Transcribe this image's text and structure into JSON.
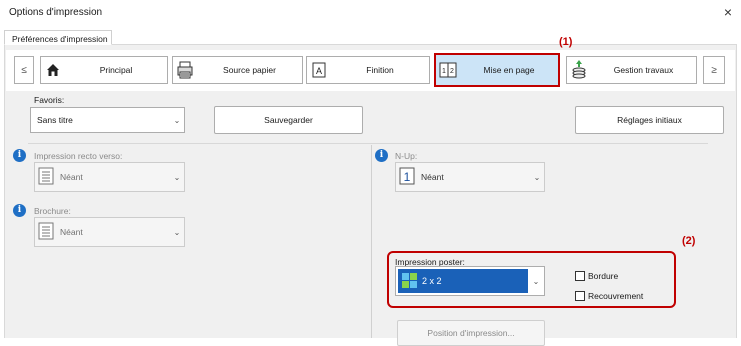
{
  "window": {
    "title": "Options d'impression",
    "close_glyph": "×"
  },
  "tab": {
    "label": "Préférences d'impression"
  },
  "nav": {
    "prev_glyph": "≤",
    "next_glyph": "≥",
    "buttons": [
      {
        "label": "Principal",
        "icon": "home-icon"
      },
      {
        "label": "Source papier",
        "icon": "printer-icon"
      },
      {
        "label": "Finition",
        "icon": "finishing-icon"
      },
      {
        "label": "Mise en page",
        "icon": "layout-icon",
        "icon_text": "1|2",
        "active": true
      },
      {
        "label": "Gestion travaux",
        "icon": "job-stack-icon"
      }
    ]
  },
  "callouts": {
    "c1": "(1)",
    "c2": "(2)"
  },
  "favorites": {
    "label": "Favoris:",
    "value": "Sans titre",
    "save_button": "Sauvegarder",
    "reset_button": "Réglages initiaux"
  },
  "duplex": {
    "label": "Impression recto verso:",
    "value": "Néant"
  },
  "booklet": {
    "label": "Brochure:",
    "value": "Néant"
  },
  "nup": {
    "label": "N-Up:",
    "value": "Néant",
    "icon_text": "1"
  },
  "poster": {
    "label": "Impression poster:",
    "value": "2 x 2",
    "border_label": "Bordure",
    "overlap_label": "Recouvrement",
    "border_checked": false,
    "overlap_checked": false
  },
  "position_button": "Position d'impression..."
}
